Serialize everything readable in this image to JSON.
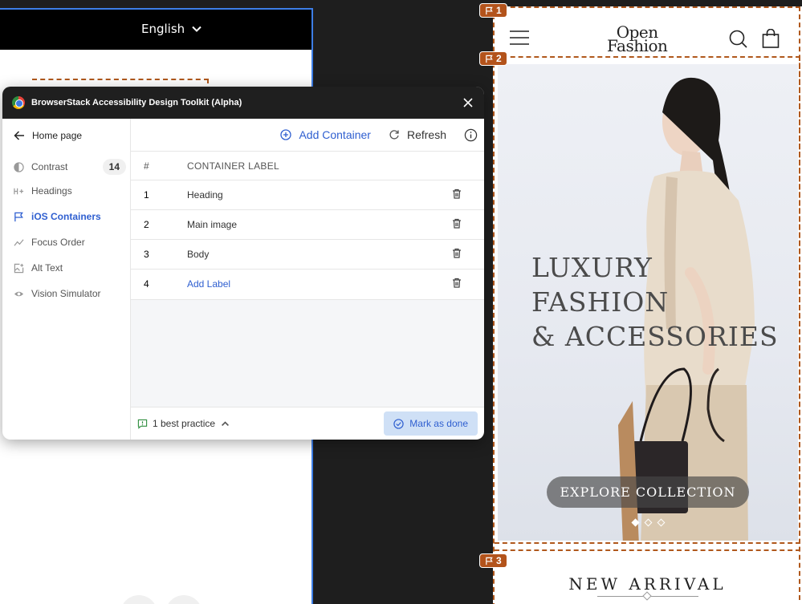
{
  "left_frame": {
    "language_label": "English"
  },
  "right_frame": {
    "logo_line1": "Open",
    "logo_line2": "Fashion",
    "hero_title_line1": "LUXURY",
    "hero_title_line2": "FASHION",
    "hero_title_line3": "& ACCESSORIES",
    "explore_label": "EXPLORE COLLECTION",
    "new_arrival": "NEW ARRIVAL",
    "tags": [
      "1",
      "2",
      "3"
    ]
  },
  "panel": {
    "title": "BrowserStack Accessibility Design Toolkit (Alpha)",
    "back_label": "Home page",
    "nav": [
      {
        "label": "Contrast",
        "badge": "14"
      },
      {
        "label": "Headings"
      },
      {
        "label": "iOS Containers"
      },
      {
        "label": "Focus Order"
      },
      {
        "label": "Alt Text"
      },
      {
        "label": "Vision Simulator"
      }
    ],
    "add_container_label": "Add Container",
    "refresh_label": "Refresh",
    "table": {
      "headers": [
        "#",
        "CONTAINER LABEL"
      ],
      "rows": [
        {
          "num": "1",
          "label": "Heading"
        },
        {
          "num": "2",
          "label": "Main image"
        },
        {
          "num": "3",
          "label": "Body"
        },
        {
          "num": "4",
          "label": "Add Label"
        }
      ]
    },
    "best_practice_label": "1 best practice",
    "mark_done_label": "Mark as done"
  },
  "colors": {
    "accent": "#2f5fd0",
    "tag": "#b3531b",
    "frame_border": "#3d7ee6"
  }
}
